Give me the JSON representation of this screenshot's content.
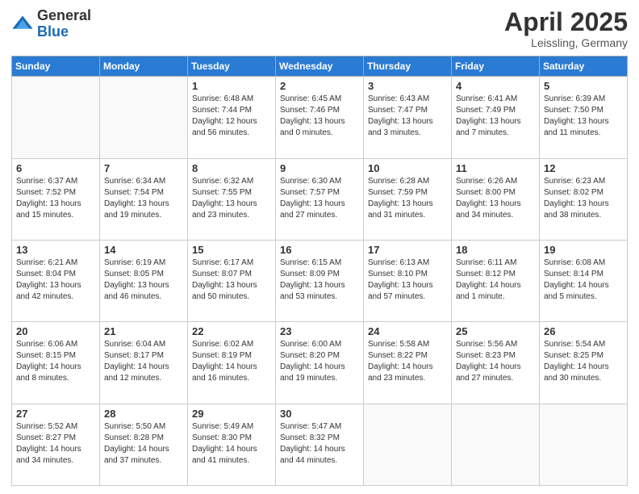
{
  "header": {
    "logo_general": "General",
    "logo_blue": "Blue",
    "month_title": "April 2025",
    "location": "Leissling, Germany"
  },
  "days_of_week": [
    "Sunday",
    "Monday",
    "Tuesday",
    "Wednesday",
    "Thursday",
    "Friday",
    "Saturday"
  ],
  "weeks": [
    [
      {
        "day": "",
        "info": ""
      },
      {
        "day": "",
        "info": ""
      },
      {
        "day": "1",
        "info": "Sunrise: 6:48 AM\nSunset: 7:44 PM\nDaylight: 12 hours and 56 minutes."
      },
      {
        "day": "2",
        "info": "Sunrise: 6:45 AM\nSunset: 7:46 PM\nDaylight: 13 hours and 0 minutes."
      },
      {
        "day": "3",
        "info": "Sunrise: 6:43 AM\nSunset: 7:47 PM\nDaylight: 13 hours and 3 minutes."
      },
      {
        "day": "4",
        "info": "Sunrise: 6:41 AM\nSunset: 7:49 PM\nDaylight: 13 hours and 7 minutes."
      },
      {
        "day": "5",
        "info": "Sunrise: 6:39 AM\nSunset: 7:50 PM\nDaylight: 13 hours and 11 minutes."
      }
    ],
    [
      {
        "day": "6",
        "info": "Sunrise: 6:37 AM\nSunset: 7:52 PM\nDaylight: 13 hours and 15 minutes."
      },
      {
        "day": "7",
        "info": "Sunrise: 6:34 AM\nSunset: 7:54 PM\nDaylight: 13 hours and 19 minutes."
      },
      {
        "day": "8",
        "info": "Sunrise: 6:32 AM\nSunset: 7:55 PM\nDaylight: 13 hours and 23 minutes."
      },
      {
        "day": "9",
        "info": "Sunrise: 6:30 AM\nSunset: 7:57 PM\nDaylight: 13 hours and 27 minutes."
      },
      {
        "day": "10",
        "info": "Sunrise: 6:28 AM\nSunset: 7:59 PM\nDaylight: 13 hours and 31 minutes."
      },
      {
        "day": "11",
        "info": "Sunrise: 6:26 AM\nSunset: 8:00 PM\nDaylight: 13 hours and 34 minutes."
      },
      {
        "day": "12",
        "info": "Sunrise: 6:23 AM\nSunset: 8:02 PM\nDaylight: 13 hours and 38 minutes."
      }
    ],
    [
      {
        "day": "13",
        "info": "Sunrise: 6:21 AM\nSunset: 8:04 PM\nDaylight: 13 hours and 42 minutes."
      },
      {
        "day": "14",
        "info": "Sunrise: 6:19 AM\nSunset: 8:05 PM\nDaylight: 13 hours and 46 minutes."
      },
      {
        "day": "15",
        "info": "Sunrise: 6:17 AM\nSunset: 8:07 PM\nDaylight: 13 hours and 50 minutes."
      },
      {
        "day": "16",
        "info": "Sunrise: 6:15 AM\nSunset: 8:09 PM\nDaylight: 13 hours and 53 minutes."
      },
      {
        "day": "17",
        "info": "Sunrise: 6:13 AM\nSunset: 8:10 PM\nDaylight: 13 hours and 57 minutes."
      },
      {
        "day": "18",
        "info": "Sunrise: 6:11 AM\nSunset: 8:12 PM\nDaylight: 14 hours and 1 minute."
      },
      {
        "day": "19",
        "info": "Sunrise: 6:08 AM\nSunset: 8:14 PM\nDaylight: 14 hours and 5 minutes."
      }
    ],
    [
      {
        "day": "20",
        "info": "Sunrise: 6:06 AM\nSunset: 8:15 PM\nDaylight: 14 hours and 8 minutes."
      },
      {
        "day": "21",
        "info": "Sunrise: 6:04 AM\nSunset: 8:17 PM\nDaylight: 14 hours and 12 minutes."
      },
      {
        "day": "22",
        "info": "Sunrise: 6:02 AM\nSunset: 8:19 PM\nDaylight: 14 hours and 16 minutes."
      },
      {
        "day": "23",
        "info": "Sunrise: 6:00 AM\nSunset: 8:20 PM\nDaylight: 14 hours and 19 minutes."
      },
      {
        "day": "24",
        "info": "Sunrise: 5:58 AM\nSunset: 8:22 PM\nDaylight: 14 hours and 23 minutes."
      },
      {
        "day": "25",
        "info": "Sunrise: 5:56 AM\nSunset: 8:23 PM\nDaylight: 14 hours and 27 minutes."
      },
      {
        "day": "26",
        "info": "Sunrise: 5:54 AM\nSunset: 8:25 PM\nDaylight: 14 hours and 30 minutes."
      }
    ],
    [
      {
        "day": "27",
        "info": "Sunrise: 5:52 AM\nSunset: 8:27 PM\nDaylight: 14 hours and 34 minutes."
      },
      {
        "day": "28",
        "info": "Sunrise: 5:50 AM\nSunset: 8:28 PM\nDaylight: 14 hours and 37 minutes."
      },
      {
        "day": "29",
        "info": "Sunrise: 5:49 AM\nSunset: 8:30 PM\nDaylight: 14 hours and 41 minutes."
      },
      {
        "day": "30",
        "info": "Sunrise: 5:47 AM\nSunset: 8:32 PM\nDaylight: 14 hours and 44 minutes."
      },
      {
        "day": "",
        "info": ""
      },
      {
        "day": "",
        "info": ""
      },
      {
        "day": "",
        "info": ""
      }
    ]
  ]
}
